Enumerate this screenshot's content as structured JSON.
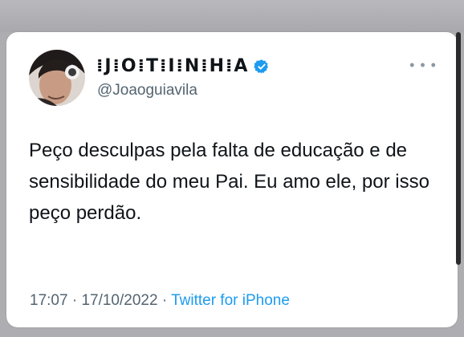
{
  "tweet": {
    "display_name": "⁞J⁞O⁞T⁞I⁞N⁞H⁞A",
    "handle": "@Joaoguiavila",
    "text": "Peço desculpas pela falta de educação e de sensibilidade do meu Pai. Eu amo ele, por isso peço perdão.",
    "time": "17:07",
    "date": "17/10/2022",
    "separator": "·",
    "source": "Twitter for iPhone",
    "verified_icon": "verified-badge-icon",
    "more_icon": "more-options-icon"
  },
  "colors": {
    "background": "#aeaeb2",
    "card": "#ffffff",
    "text": "#0f1419",
    "secondary": "#536471",
    "accent": "#1d9bf0"
  }
}
